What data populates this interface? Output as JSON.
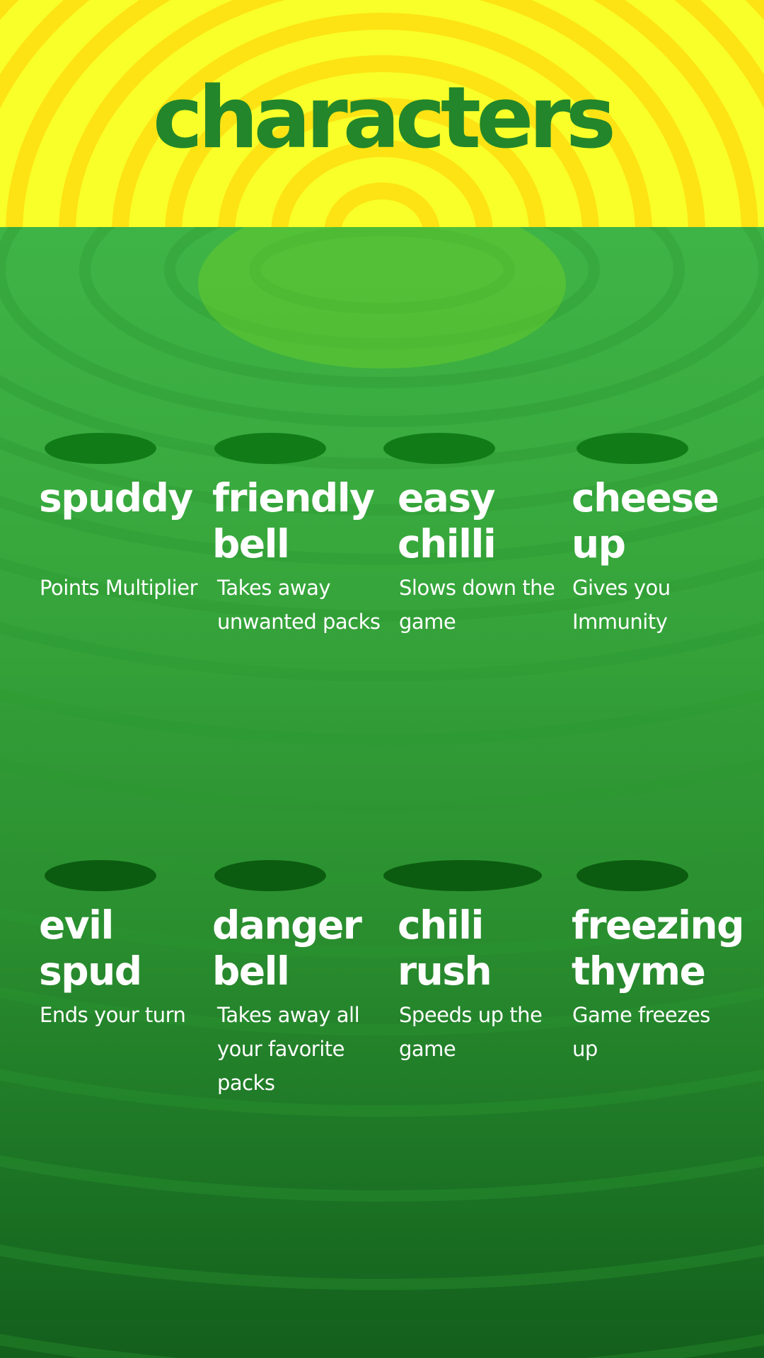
{
  "page": {
    "title": "characters"
  },
  "colors": {
    "header_background": "#f8ff29",
    "header_ring": "#fde313",
    "title_text": "#23862a",
    "field_top": "#3fb446",
    "field_bottom": "#135f1c",
    "card_text": "#ffffff",
    "shadow_light": "#117c17",
    "shadow_dark": "#0b5c10"
  },
  "characters": [
    {
      "name": "spuddy",
      "description": "Points Multiplier"
    },
    {
      "name": "friendly\nbell",
      "description": "Takes away\nunwanted packs"
    },
    {
      "name": "easy\nchilli",
      "description": "Slows down the\ngame"
    },
    {
      "name": "cheese\nup",
      "description": "Gives you\nImmunity"
    },
    {
      "name": "evil\nspud",
      "description": "Ends your turn"
    },
    {
      "name": "danger\nbell",
      "description": "Takes away all\nyour favorite\npacks"
    },
    {
      "name": "chili\nrush",
      "description": "Speeds up the\ngame"
    },
    {
      "name": "freezing\nthyme",
      "description": "Game freezes\nup"
    }
  ]
}
